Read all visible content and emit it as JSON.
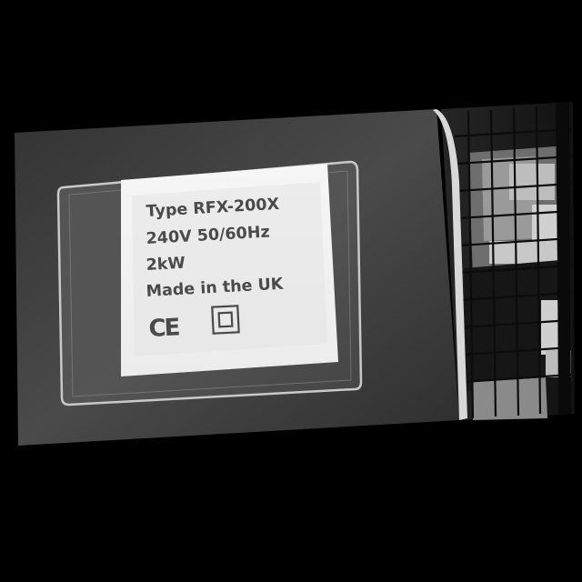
{
  "photo": {
    "description_tag": "rating-label-photo",
    "palette": {
      "background": "#000000",
      "panel": "#3f3f3f",
      "label_paper": "#f2f2f2",
      "label_inner": "#e3e3e3",
      "label_ink": "#4a4a4a",
      "background_scene": "#1b1b1b"
    }
  },
  "label": {
    "line1": "Type RFX-200X",
    "line2": "240V 50/60Hz",
    "line3": "2kW",
    "line4": "Made in the UK",
    "ce_mark": "CE"
  }
}
